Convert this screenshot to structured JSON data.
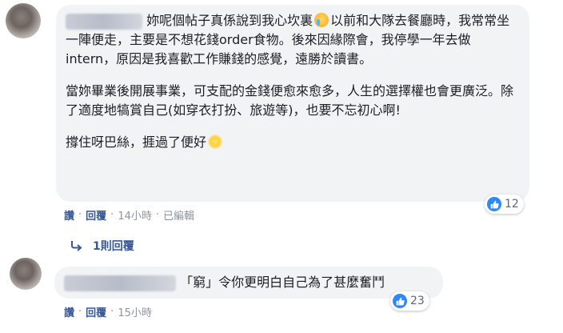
{
  "comments": [
    {
      "paragraphs": [
        "妳呢個帖子真係說到我心坎裏",
        "以前和大隊去餐廳時，我常常坐一陣便走，主要是不想花錢order食物。後來因緣際會，我停學一年去做intern，原因是我喜歡工作賺錢的感覺，遠勝於讀書。",
        "當妳畢業後開展事業，可支配的金錢便愈來愈多，人生的選擇權也會更廣泛。除了適度地犒賞自己(如穿衣打扮、旅遊等)，也要不忘初心啊!",
        "撐住呀巴絲，捱過了便好"
      ],
      "reaction_count": "12",
      "actions": {
        "like": "讚",
        "reply": "回覆",
        "time": "14小時",
        "edited": "已編輯"
      },
      "replies_link": "1則回覆",
      "emoji": [
        "crying-face",
        "sun"
      ]
    },
    {
      "text": "「窮」令你更明白自己為了甚麼奮鬥",
      "reaction_count": "23",
      "actions": {
        "like": "讚",
        "reply": "回覆",
        "time": "15小時"
      }
    }
  ],
  "separator": "·",
  "colors": {
    "bubble": "#f2f3f5",
    "link": "#385898",
    "meta": "#90949c",
    "like_blue": "#2d88ff"
  }
}
